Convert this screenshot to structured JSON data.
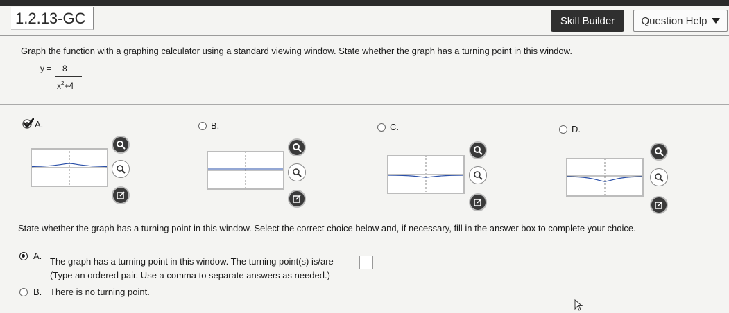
{
  "header": {
    "title": "1.2.13-GC",
    "skill_builder": "Skill Builder",
    "question_help": "Question Help"
  },
  "question": {
    "instruction": "Graph the function with a graphing calculator using a standard viewing window. State whether the graph has a turning point in this window.",
    "function_lhs": "y =",
    "numerator": "8",
    "denominator_base": "x",
    "denominator_exp": "2",
    "denominator_rest": "+4"
  },
  "graph_choices": [
    {
      "letter": "A.",
      "selected": true
    },
    {
      "letter": "B.",
      "selected": false
    },
    {
      "letter": "C.",
      "selected": false
    },
    {
      "letter": "D.",
      "selected": false
    }
  ],
  "turning_question": "State whether the graph has a turning point in this window. Select the correct choice below and, if necessary, fill in the answer box to complete your choice.",
  "options": {
    "a_letter": "A.",
    "a_text": "The graph has a turning point in this window. The turning point(s) is/are",
    "a_hint": "(Type an ordered pair. Use a comma to separate answers as needed.)",
    "b_letter": "B.",
    "b_text": "There is no turning point."
  },
  "colors": {
    "accent_dark": "#2f2f2f",
    "background": "#f4f4f2"
  }
}
